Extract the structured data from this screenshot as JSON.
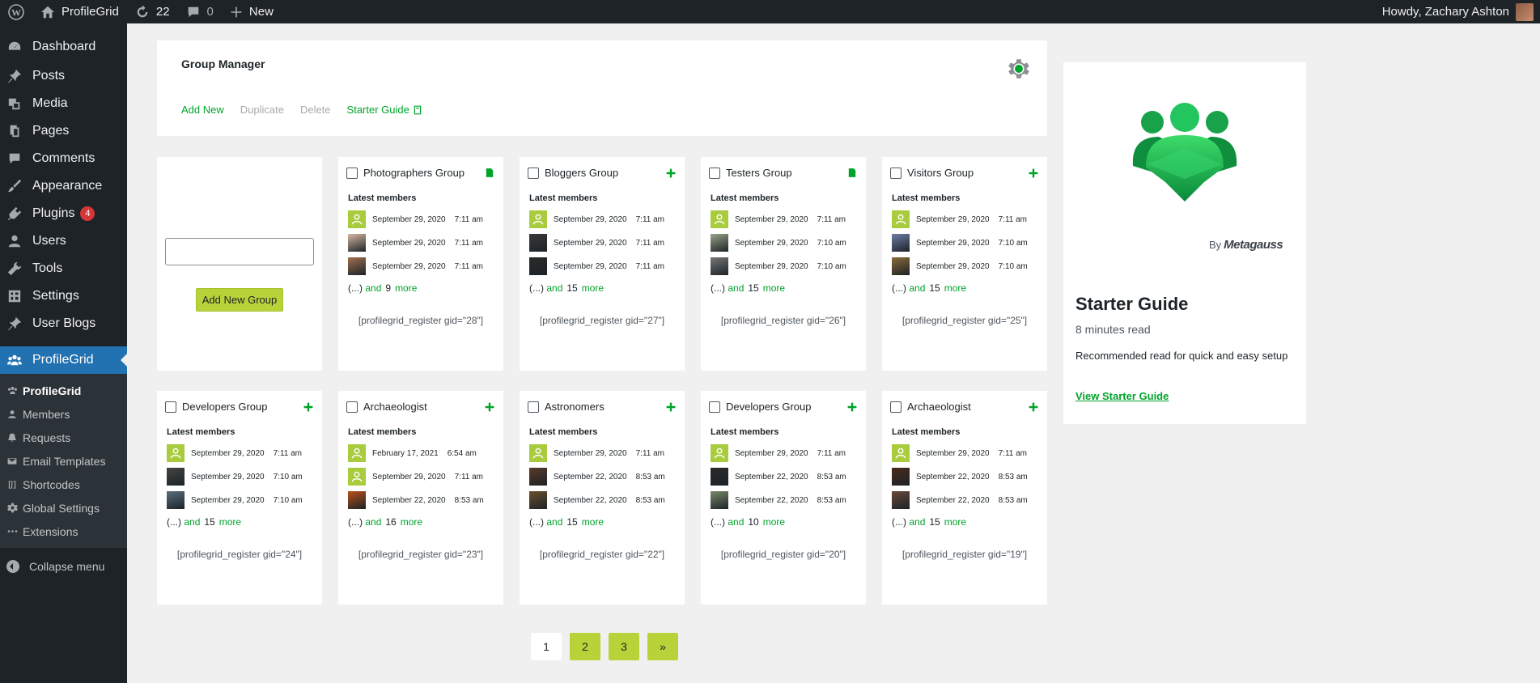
{
  "admin_bar": {
    "site_name": "ProfileGrid",
    "updates_count": "22",
    "comments_count": "0",
    "new_label": "New",
    "howdy": "Howdy, Zachary Ashton"
  },
  "sidebar": {
    "items": [
      {
        "label": "Dashboard",
        "icon": "dashboard-icon"
      },
      {
        "label": "Posts",
        "icon": "pin-icon"
      },
      {
        "label": "Media",
        "icon": "media-icon"
      },
      {
        "label": "Pages",
        "icon": "pages-icon"
      },
      {
        "label": "Comments",
        "icon": "comment-icon"
      },
      {
        "label": "Appearance",
        "icon": "brush-icon"
      },
      {
        "label": "Plugins",
        "icon": "plugin-icon",
        "badge": "4"
      },
      {
        "label": "Users",
        "icon": "user-icon"
      },
      {
        "label": "Tools",
        "icon": "wrench-icon"
      },
      {
        "label": "Settings",
        "icon": "settings-icon"
      },
      {
        "label": "User Blogs",
        "icon": "pin-icon"
      },
      {
        "label": "ProfileGrid",
        "icon": "group-icon"
      }
    ],
    "submenu": [
      {
        "label": "ProfileGrid"
      },
      {
        "label": "Members"
      },
      {
        "label": "Requests"
      },
      {
        "label": "Email Templates"
      },
      {
        "label": "Shortcodes"
      },
      {
        "label": "Global Settings"
      },
      {
        "label": "Extensions"
      }
    ],
    "collapse_label": "Collapse menu"
  },
  "group_manager": {
    "title": "Group Manager",
    "add_new": "Add New",
    "duplicate": "Duplicate",
    "delete": "Delete",
    "starter_guide": "Starter Guide"
  },
  "add_group": {
    "input_value": "",
    "button_label": "Add New Group"
  },
  "common": {
    "latest_members": "Latest members",
    "ellipsis": "(...)",
    "and": "and",
    "more": "more"
  },
  "groups": [
    {
      "name": "Photographers Group",
      "icon": "document-icon",
      "members": [
        {
          "avatar": "default",
          "date": "September 29, 2020",
          "time": "7:11 am"
        },
        {
          "avatar": "photo",
          "color": "#d9b7a3",
          "date": "September 29, 2020",
          "time": "7:11 am"
        },
        {
          "avatar": "photo",
          "color": "#a07050",
          "date": "September 29, 2020",
          "time": "7:11 am"
        }
      ],
      "more_count": "9",
      "shortcode": "[profilegrid_register gid=\"28\"]"
    },
    {
      "name": "Bloggers Group",
      "icon": "plus-icon",
      "members": [
        {
          "avatar": "default",
          "date": "September 29, 2020",
          "time": "7:11 am"
        },
        {
          "avatar": "photo",
          "color": "#3a3a3a",
          "date": "September 29, 2020",
          "time": "7:11 am"
        },
        {
          "avatar": "photo",
          "color": "#2a2a2a",
          "date": "September 29, 2020",
          "time": "7:11 am"
        }
      ],
      "more_count": "15",
      "shortcode": "[profilegrid_register gid=\"27\"]"
    },
    {
      "name": "Testers Group",
      "icon": "document-icon",
      "members": [
        {
          "avatar": "default",
          "date": "September 29, 2020",
          "time": "7:11 am"
        },
        {
          "avatar": "photo",
          "color": "#9aa38a",
          "date": "September 29, 2020",
          "time": "7:10 am"
        },
        {
          "avatar": "photo",
          "color": "#777777",
          "date": "September 29, 2020",
          "time": "7:10 am"
        }
      ],
      "more_count": "15",
      "shortcode": "[profilegrid_register gid=\"26\"]"
    },
    {
      "name": "Visitors Group",
      "icon": "plus-icon",
      "members": [
        {
          "avatar": "default",
          "date": "September 29, 2020",
          "time": "7:11 am"
        },
        {
          "avatar": "photo",
          "color": "#6d7fa6",
          "date": "September 29, 2020",
          "time": "7:10 am"
        },
        {
          "avatar": "photo",
          "color": "#8a6a3a",
          "date": "September 29, 2020",
          "time": "7:10 am"
        }
      ],
      "more_count": "15",
      "shortcode": "[profilegrid_register gid=\"25\"]"
    },
    {
      "name": "Developers Group",
      "icon": "plus-icon",
      "members": [
        {
          "avatar": "default",
          "date": "September 29, 2020",
          "time": "7:11 am"
        },
        {
          "avatar": "photo",
          "color": "#444444",
          "date": "September 29, 2020",
          "time": "7:10 am"
        },
        {
          "avatar": "photo",
          "color": "#5a7080",
          "date": "September 29, 2020",
          "time": "7:10 am"
        }
      ],
      "more_count": "15",
      "shortcode": "[profilegrid_register gid=\"24\"]"
    },
    {
      "name": "Archaeologist",
      "icon": "plus-icon",
      "members": [
        {
          "avatar": "default",
          "date": "February 17, 2021",
          "time": "6:54 am"
        },
        {
          "avatar": "default",
          "date": "September 29, 2020",
          "time": "7:11 am"
        },
        {
          "avatar": "photo",
          "color": "#b8501a",
          "date": "September 22, 2020",
          "time": "8:53 am"
        }
      ],
      "more_count": "16",
      "shortcode": "[profilegrid_register gid=\"23\"]"
    },
    {
      "name": "Astronomers",
      "icon": "plus-icon",
      "members": [
        {
          "avatar": "default",
          "date": "September 29, 2020",
          "time": "7:11 am"
        },
        {
          "avatar": "photo",
          "color": "#5a3a2a",
          "date": "September 22, 2020",
          "time": "8:53 am"
        },
        {
          "avatar": "photo",
          "color": "#6a5030",
          "date": "September 22, 2020",
          "time": "8:53 am"
        }
      ],
      "more_count": "15",
      "shortcode": "[profilegrid_register gid=\"22\"]"
    },
    {
      "name": "Developers Group",
      "icon": "plus-icon",
      "members": [
        {
          "avatar": "default",
          "date": "September 29, 2020",
          "time": "7:11 am"
        },
        {
          "avatar": "photo",
          "color": "#2a2a2a",
          "date": "September 22, 2020",
          "time": "8:53 am"
        },
        {
          "avatar": "photo",
          "color": "#7a8a6a",
          "date": "September 22, 2020",
          "time": "8:53 am"
        }
      ],
      "more_count": "10",
      "shortcode": "[profilegrid_register gid=\"20\"]"
    },
    {
      "name": "Archaeologist",
      "icon": "plus-icon",
      "members": [
        {
          "avatar": "default",
          "date": "September 29, 2020",
          "time": "7:11 am"
        },
        {
          "avatar": "photo",
          "color": "#4a2a1a",
          "date": "September 22, 2020",
          "time": "8:53 am"
        },
        {
          "avatar": "photo",
          "color": "#6a4a3a",
          "date": "September 22, 2020",
          "time": "8:53 am"
        }
      ],
      "more_count": "15",
      "shortcode": "[profilegrid_register gid=\"19\"]"
    }
  ],
  "starter_guide": {
    "by_label": "By",
    "brand": "Metagauss",
    "title": "Starter Guide",
    "read_time": "8 minutes read",
    "description": "Recommended read for quick and easy setup",
    "link": "View Starter Guide"
  },
  "pagination": {
    "pages": [
      "1",
      "2",
      "3",
      "»"
    ],
    "current": "1"
  },
  "colors": {
    "accent_green": "#00a32a",
    "button_lime": "#b8d33a",
    "admin_dark": "#1d2327",
    "active_blue": "#2271b1"
  }
}
